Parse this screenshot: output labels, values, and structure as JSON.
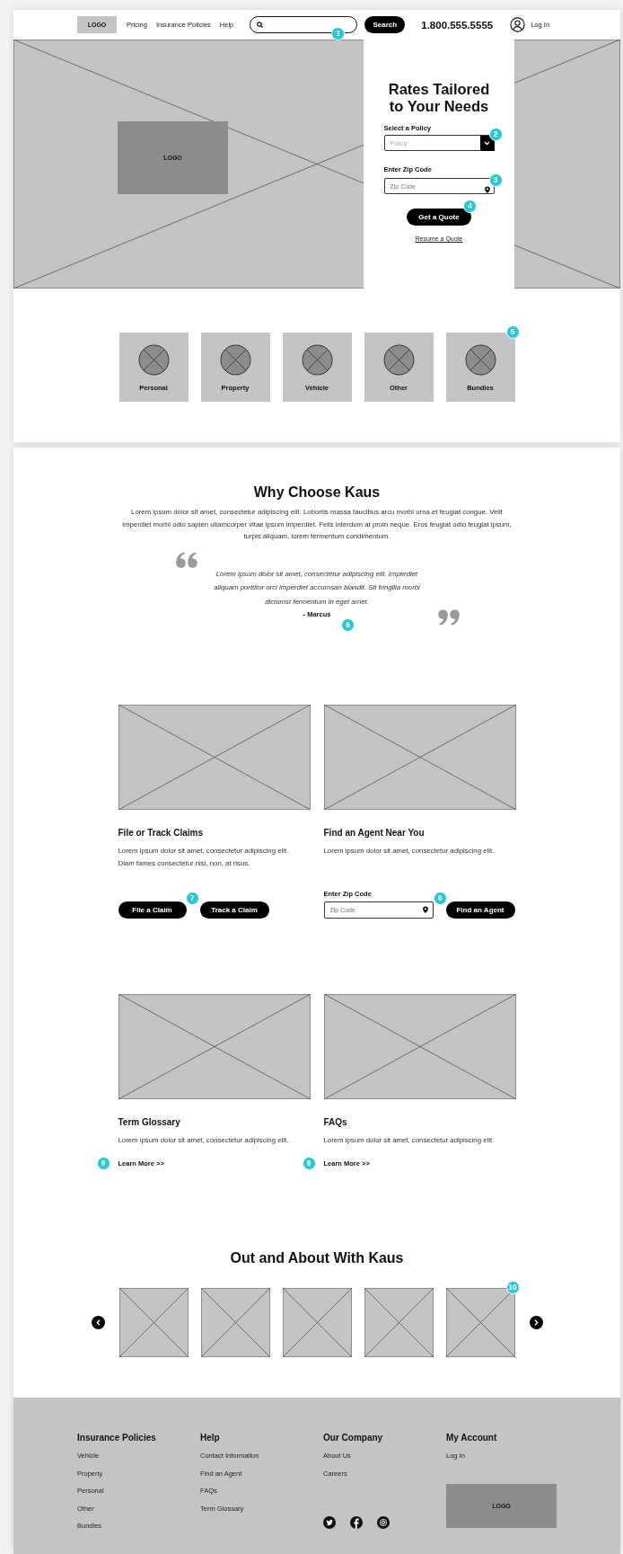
{
  "header": {
    "logo": "LOGO",
    "nav": [
      "Pricing",
      "Insurance Policies",
      "Help"
    ],
    "search": {
      "annotation": "1"
    },
    "search_button": "Search",
    "phone": "1.800.555.5555",
    "login": "Log In"
  },
  "hero": {
    "logo": "LOGO",
    "title": "Rates Tailored to Your Needs",
    "policy_label": "Select a Policy",
    "policy_placeholder": "Policy",
    "policy_annotation": "2",
    "zip_label": "Enter Zip Code",
    "zip_placeholder": "Zip Code",
    "zip_annotation": "3",
    "quote_button": "Get a Quote",
    "quote_annotation": "4",
    "resume_link": "Resume a Quote"
  },
  "categories": {
    "annotation": "5",
    "items": [
      "Personal",
      "Property",
      "Vehicle",
      "Other",
      "Bundles"
    ]
  },
  "why": {
    "title": "Why Choose Kaus",
    "text": "Lorem ipsum dolor sit amet, consectetur adipiscing elit. Lobortis massa faucibus arcu morbi urna et feugiat congue. Velit imperdiet morbi odio sapien ullamcorper vitae ipsum imperdiet. Felis interdum at proin neque. Eros feugiat odio feugiat ipsum, turpis aliquam, lorem fermentum condimentum.",
    "quote": "Lorem ipsum dolor sit amet, consectetur adipiscing elit. Imperdiet aliquam porttitor orci imperdiet accumsan blandit. Sit fringilla morbi dictumst fermentum in eget amet.",
    "author": "- Marcus",
    "annotation": "6"
  },
  "features": [
    {
      "kind": "buttons",
      "title": "File or Track Claims",
      "text": "Lorem ipsum dolor sit amet, consectetur adipiscing elit. Diam fames consectetur nisi, non, at risus.",
      "buttons": [
        "File a Claim",
        "Track a Claim"
      ],
      "annotation": "7"
    },
    {
      "kind": "zip",
      "title": "Find an Agent Near You",
      "text": "Lorem ipsum dolor sit amet, consectetur adipiscing elit.",
      "zip_label": "Enter Zip Code",
      "zip_placeholder": "Zip Code",
      "button": "Find an Agent",
      "annotation": "8"
    },
    {
      "kind": "link",
      "title": "Term Glossary",
      "text": "Lorem ipsum dolor sit amet, consectetur adipiscing elit.",
      "link": "Learn More >>",
      "annotation": "9"
    },
    {
      "kind": "link",
      "title": "FAQs",
      "text": "Lorem ipsum dolor sit amet, consectetur adipiscing elit.",
      "link": "Learn More >>",
      "annotation": "9"
    }
  ],
  "gallery": {
    "title": "Out and About With Kaus",
    "annotation": "10",
    "tiles": [
      {
        "kind": "placeholder"
      },
      {
        "kind": "placeholder"
      },
      {
        "kind": "placeholder"
      },
      {
        "kind": "placeholder"
      },
      {
        "kind": "placeholder"
      }
    ]
  },
  "footer": {
    "columns": [
      {
        "title": "Insurance Policies",
        "links": [
          "Vehicle",
          "Property",
          "Personal",
          "Other",
          "Bundles"
        ]
      },
      {
        "title": "Help",
        "links": [
          "Contact Information",
          "Find an Agent",
          "FAQs",
          "Term Glossary"
        ]
      },
      {
        "title": "Our Company",
        "links": [
          "About Us",
          "Careers"
        ],
        "social": [
          {
            "kind": "twitter"
          },
          {
            "kind": "facebook"
          },
          {
            "kind": "instagram"
          }
        ]
      },
      {
        "title": "My Account",
        "links": [
          "Log In"
        ],
        "logo": "LOGO"
      }
    ]
  }
}
